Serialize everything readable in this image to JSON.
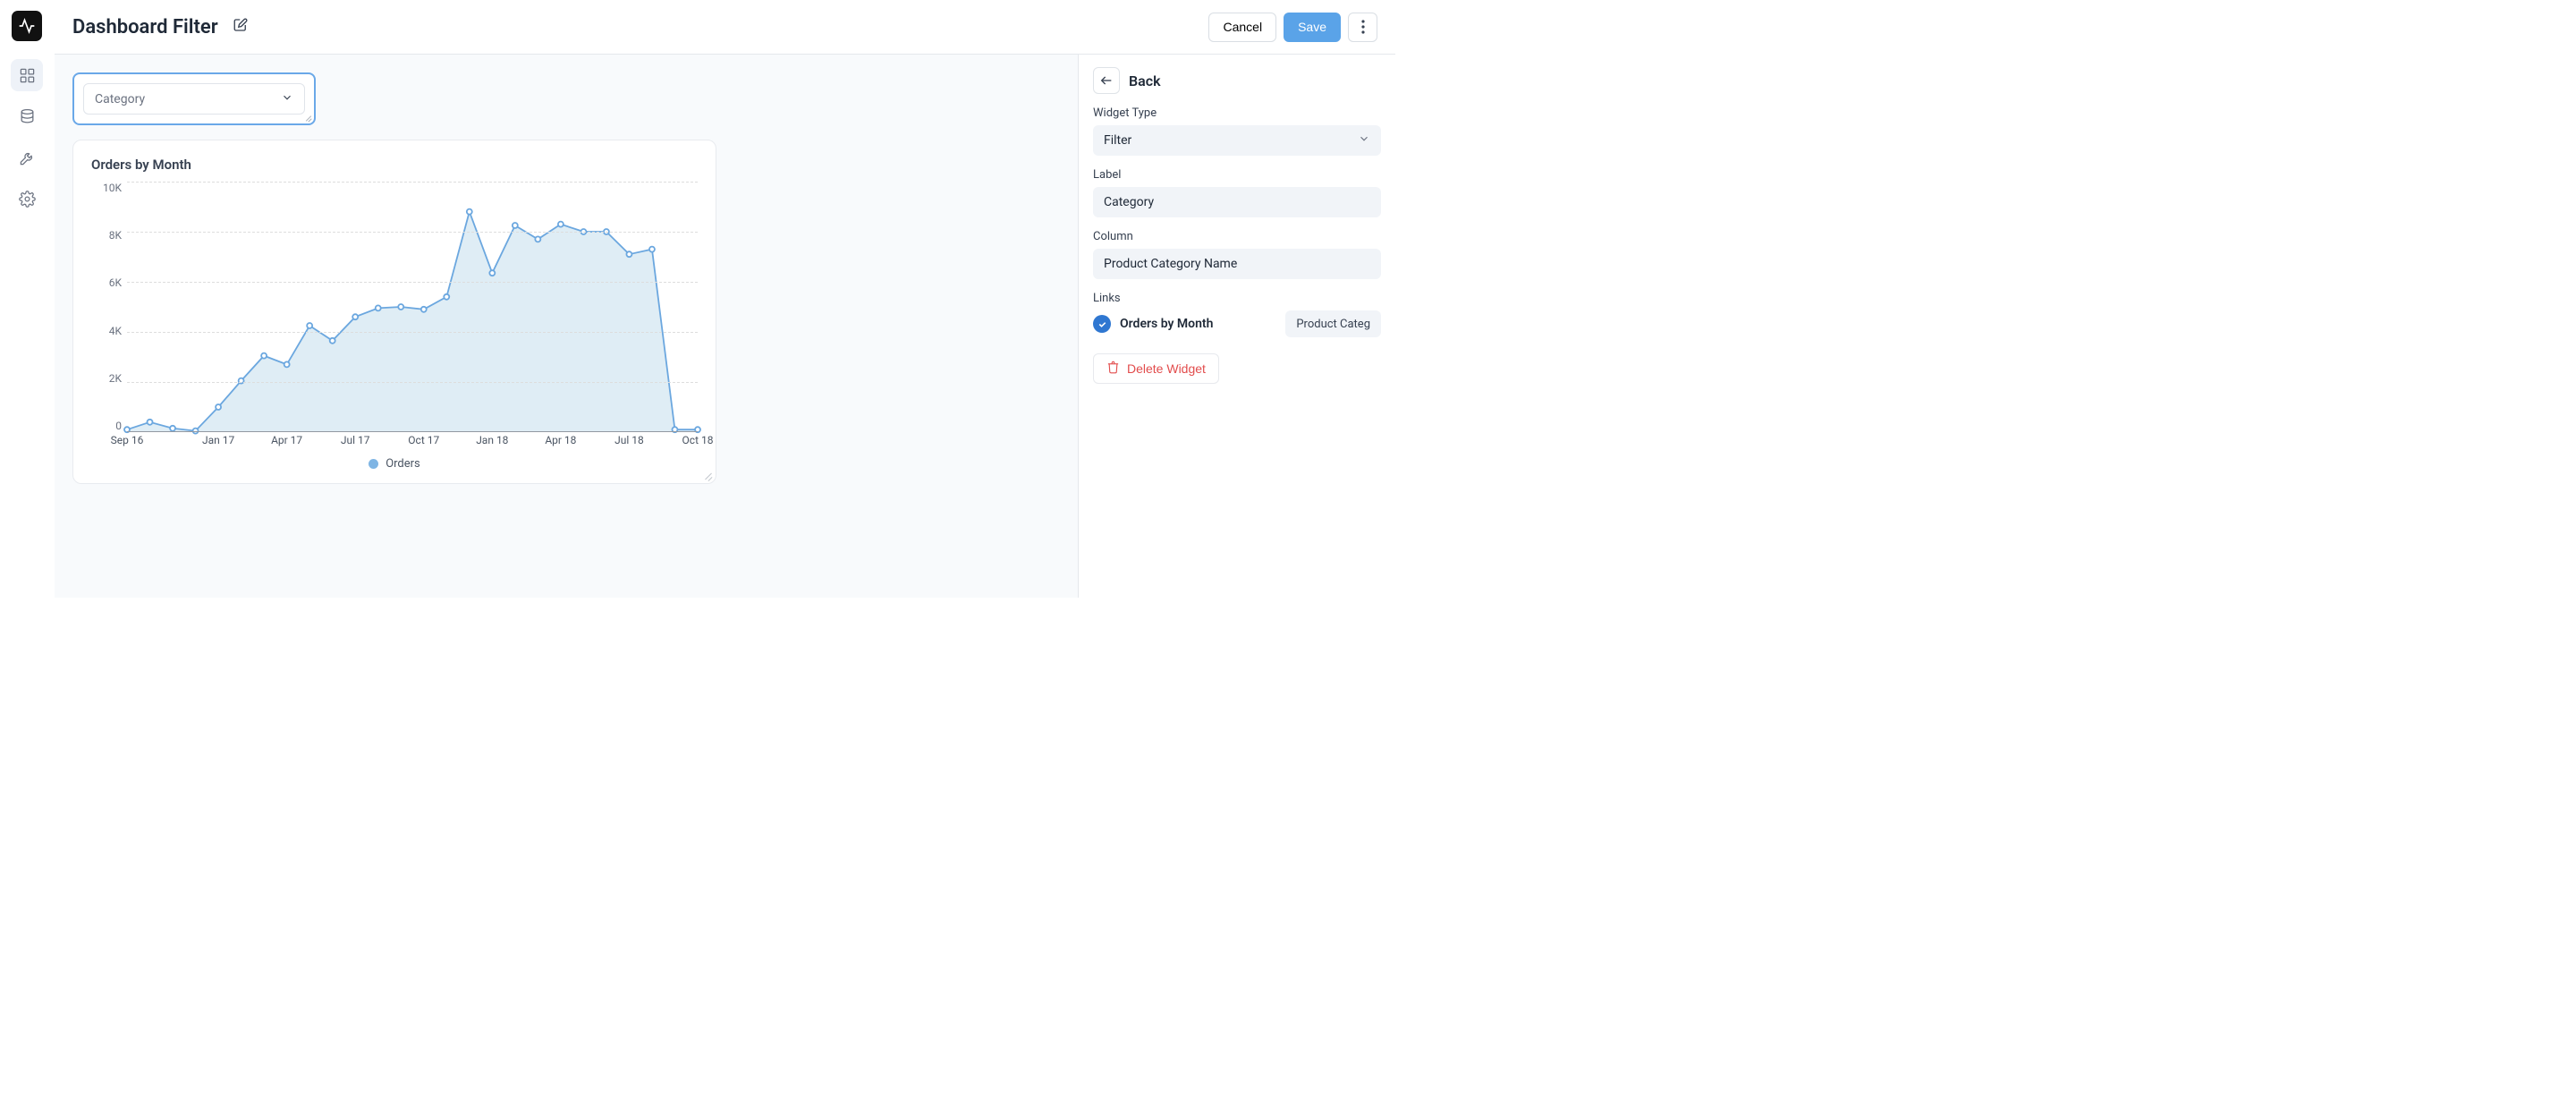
{
  "header": {
    "page_title": "Dashboard Filter",
    "cancel_label": "Cancel",
    "save_label": "Save"
  },
  "filter_widget": {
    "selected_label": "Category"
  },
  "chart": {
    "title": "Orders by Month",
    "legend_label": "Orders"
  },
  "inspector": {
    "back_label": "Back",
    "widget_type_label": "Widget Type",
    "widget_type_value": "Filter",
    "label_label": "Label",
    "label_value": "Category",
    "column_label": "Column",
    "column_value": "Product Category Name",
    "links_label": "Links",
    "link_name": "Orders by Month",
    "link_column": "Product Categ",
    "delete_label": "Delete Widget"
  },
  "chart_data": {
    "type": "line",
    "title": "Orders by Month",
    "xlabel": "",
    "ylabel": "",
    "ylim": [
      0,
      10000
    ],
    "y_ticks": [
      "10K",
      "8K",
      "6K",
      "4K",
      "2K",
      "0"
    ],
    "x_tick_labels": [
      "Sep 16",
      "Jan 17",
      "Apr 17",
      "Jul 17",
      "Oct 17",
      "Jan 18",
      "Apr 18",
      "Jul 18",
      "Oct 18"
    ],
    "x_tick_positions": [
      0,
      4,
      7,
      10,
      13,
      16,
      19,
      22,
      25
    ],
    "series": [
      {
        "name": "Orders",
        "x": [
          "Sep 16",
          "Oct 16",
          "Nov 16",
          "Dec 16",
          "Jan 17",
          "Feb 17",
          "Mar 17",
          "Apr 17",
          "May 17",
          "Jun 17",
          "Jul 17",
          "Aug 17",
          "Sep 17",
          "Oct 17",
          "Nov 17",
          "Dec 17",
          "Jan 18",
          "Feb 18",
          "Mar 18",
          "Apr 18",
          "May 18",
          "Jun 18",
          "Jul 18",
          "Aug 18",
          "Sep 18",
          "Oct 18"
        ],
        "values": [
          100,
          400,
          150,
          50,
          1000,
          2050,
          3050,
          2700,
          4250,
          3650,
          4600,
          4950,
          5000,
          4900,
          5400,
          8800,
          6350,
          8250,
          7700,
          8300,
          8000,
          8000,
          7100,
          7300,
          100,
          100
        ]
      }
    ]
  }
}
